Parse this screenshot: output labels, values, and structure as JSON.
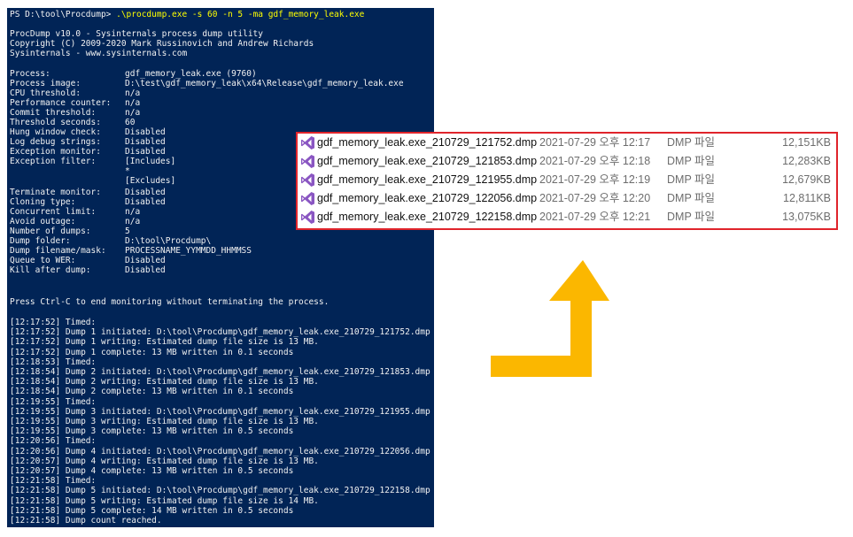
{
  "console": {
    "command_prompt": "PS D:\\tool\\Procdump> ",
    "command_text": ".\\procdump.exe -s 60 -n 5 -ma gdf_memory_leak.exe",
    "banner": [
      "ProcDump v10.0 - Sysinternals process dump utility",
      "Copyright (C) 2009-2020 Mark Russinovich and Andrew Richards",
      "Sysinternals - www.sysinternals.com"
    ],
    "settings_a": [
      {
        "key": "Process:",
        "value": "gdf_memory_leak.exe (9760)"
      },
      {
        "key": "Process image:",
        "value": "D:\\test\\gdf_memory_leak\\x64\\Release\\gdf_memory_leak.exe"
      },
      {
        "key": "CPU threshold:",
        "value": "n/a"
      },
      {
        "key": "Performance counter:",
        "value": "n/a"
      },
      {
        "key": "Commit threshold:",
        "value": "n/a"
      },
      {
        "key": "Threshold seconds:",
        "value": "60"
      },
      {
        "key": "Hung window check:",
        "value": "Disabled"
      },
      {
        "key": "Log debug strings:",
        "value": "Disabled"
      },
      {
        "key": "Exception monitor:",
        "value": "Disabled"
      },
      {
        "key": "Exception filter:",
        "value": "[Includes]"
      },
      {
        "key": "",
        "value": "*"
      },
      {
        "key": "",
        "value": "[Excludes]"
      }
    ],
    "settings_b": [
      {
        "key": "Terminate monitor:",
        "value": "Disabled"
      },
      {
        "key": "Cloning type:",
        "value": "Disabled"
      },
      {
        "key": "Concurrent limit:",
        "value": "n/a"
      },
      {
        "key": "Avoid outage:",
        "value": "n/a"
      },
      {
        "key": "Number of dumps:",
        "value": "5"
      },
      {
        "key": "Dump folder:",
        "value": "D:\\tool\\Procdump\\"
      },
      {
        "key": "Dump filename/mask:",
        "value": "PROCESSNAME_YYMMDD_HHMMSS"
      },
      {
        "key": "Queue to WER:",
        "value": "Disabled"
      },
      {
        "key": "Kill after dump:",
        "value": "Disabled"
      }
    ],
    "notice": "Press Ctrl-C to end monitoring without terminating the process.",
    "log": [
      "[12:17:52] Timed:",
      "[12:17:52] Dump 1 initiated: D:\\tool\\Procdump\\gdf_memory_leak.exe_210729_121752.dmp",
      "[12:17:52] Dump 1 writing: Estimated dump file size is 13 MB.",
      "[12:17:52] Dump 1 complete: 13 MB written in 0.1 seconds",
      "[12:18:53] Timed:",
      "[12:18:54] Dump 2 initiated: D:\\tool\\Procdump\\gdf_memory_leak.exe_210729_121853.dmp",
      "[12:18:54] Dump 2 writing: Estimated dump file size is 13 MB.",
      "[12:18:54] Dump 2 complete: 13 MB written in 0.1 seconds",
      "[12:19:55] Timed:",
      "[12:19:55] Dump 3 initiated: D:\\tool\\Procdump\\gdf_memory_leak.exe_210729_121955.dmp",
      "[12:19:55] Dump 3 writing: Estimated dump file size is 13 MB.",
      "[12:19:55] Dump 3 complete: 13 MB written in 0.5 seconds",
      "[12:20:56] Timed:",
      "[12:20:56] Dump 4 initiated: D:\\tool\\Procdump\\gdf_memory_leak.exe_210729_122056.dmp",
      "[12:20:57] Dump 4 writing: Estimated dump file size is 13 MB.",
      "[12:20:57] Dump 4 complete: 13 MB written in 0.5 seconds",
      "[12:21:58] Timed:",
      "[12:21:58] Dump 5 initiated: D:\\tool\\Procdump\\gdf_memory_leak.exe_210729_122158.dmp",
      "[12:21:58] Dump 5 writing: Estimated dump file size is 14 MB.",
      "[12:21:58] Dump 5 complete: 14 MB written in 0.5 seconds",
      "[12:21:58] Dump count reached."
    ]
  },
  "files": [
    {
      "name": "gdf_memory_leak.exe_210729_121752.dmp",
      "date": "2021-07-29 오후 12:17",
      "type": "DMP 파일",
      "size": "12,151KB"
    },
    {
      "name": "gdf_memory_leak.exe_210729_121853.dmp",
      "date": "2021-07-29 오후 12:18",
      "type": "DMP 파일",
      "size": "12,283KB"
    },
    {
      "name": "gdf_memory_leak.exe_210729_121955.dmp",
      "date": "2021-07-29 오후 12:19",
      "type": "DMP 파일",
      "size": "12,679KB"
    },
    {
      "name": "gdf_memory_leak.exe_210729_122056.dmp",
      "date": "2021-07-29 오후 12:20",
      "type": "DMP 파일",
      "size": "12,811KB"
    },
    {
      "name": "gdf_memory_leak.exe_210729_122158.dmp",
      "date": "2021-07-29 오후 12:21",
      "type": "DMP 파일",
      "size": "13,075KB"
    }
  ],
  "colors": {
    "console_bg": "#012456",
    "highlight_border": "#e0242b",
    "arrow": "#fbb700",
    "vs_icon": "#8a56c2"
  },
  "icons": {
    "file_icon": "visual-studio-icon",
    "arrow": "curved-up-arrow"
  }
}
